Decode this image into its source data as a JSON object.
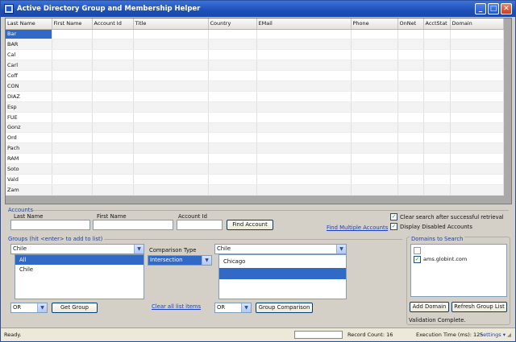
{
  "window": {
    "title": "Active Directory Group and Membership Helper",
    "buttons": {
      "minimize": "_",
      "maximize": "□",
      "close": "✕"
    }
  },
  "grid": {
    "columns": [
      "Last Name",
      "First Name",
      "Account Id",
      "Title",
      "Country",
      "EMail",
      "Phone",
      "OnNet",
      "AcctStat",
      "Domain"
    ],
    "rows": [
      [
        "Bar",
        "",
        "",
        "",
        "",
        "",
        "",
        "",
        "",
        ""
      ],
      [
        "BAR",
        "",
        "",
        "",
        "",
        "",
        "",
        "",
        "",
        ""
      ],
      [
        "Cal",
        "",
        "",
        "",
        "",
        "",
        "",
        "",
        "",
        ""
      ],
      [
        "Carl",
        "",
        "",
        "",
        "",
        "",
        "",
        "",
        "",
        ""
      ],
      [
        "Coff",
        "",
        "",
        "",
        "",
        "",
        "",
        "",
        "",
        ""
      ],
      [
        "CON",
        "",
        "",
        "",
        "",
        "",
        "",
        "",
        "",
        ""
      ],
      [
        "DIAZ",
        "",
        "",
        "",
        "",
        "",
        "",
        "",
        "",
        ""
      ],
      [
        "Esp",
        "",
        "",
        "",
        "",
        "",
        "",
        "",
        "",
        ""
      ],
      [
        "FUE",
        "",
        "",
        "",
        "",
        "",
        "",
        "",
        "",
        ""
      ],
      [
        "Gonz",
        "",
        "",
        "",
        "",
        "",
        "",
        "",
        "",
        ""
      ],
      [
        "Ord",
        "",
        "",
        "",
        "",
        "",
        "",
        "",
        "",
        ""
      ],
      [
        "Pach",
        "",
        "",
        "",
        "",
        "",
        "",
        "",
        "",
        ""
      ],
      [
        "RAM",
        "",
        "",
        "",
        "",
        "",
        "",
        "",
        "",
        ""
      ],
      [
        "Soto",
        "",
        "",
        "",
        "",
        "",
        "",
        "",
        "",
        ""
      ],
      [
        "Vald",
        "",
        "",
        "",
        "",
        "",
        "",
        "",
        "",
        ""
      ],
      [
        "Zam",
        "",
        "",
        "",
        "",
        "",
        "",
        "",
        "",
        ""
      ]
    ]
  },
  "accounts": {
    "section_label": "Accounts",
    "last_name_label": "Last Name",
    "first_name_label": "First Name",
    "account_id_label": "Account Id",
    "last_name_value": "",
    "first_name_value": "",
    "account_id_value": "",
    "find_account_button": "Find Account",
    "find_multiple_link": "Find Multiple Accounts",
    "clear_search_label": "Clear search after successful retrieval",
    "display_disabled_label": "Display Disabled Accounts"
  },
  "groups": {
    "section_label": "Groups (hit <enter> to add to list)",
    "selected_group": "Chile",
    "list_items": [
      "All",
      "Chile"
    ],
    "operator_value": "OR",
    "get_group_button": "Get Group"
  },
  "comparison": {
    "type_label": "Comparison Type",
    "type_value": "Intersection",
    "clear_all_link": "Clear all  list items",
    "selected_group": "Chile",
    "list_items": [
      "Chicago",
      ""
    ],
    "operator_value": "OR",
    "group_comparison_button": "Group Comparison"
  },
  "domains": {
    "section_label": "Domains to Search",
    "items": [
      {
        "label": "",
        "checked": false
      },
      {
        "label": "ams.globint.com",
        "checked": true
      }
    ],
    "add_domain_button": "Add Domain",
    "refresh_group_list_button": "Refresh Group List",
    "validation_text": "Validation Complete."
  },
  "status": {
    "ready_text": "Ready.",
    "record_count": "Record Count: 16",
    "execution_time": "Execution Time (ms): 125",
    "settings_label": "Settings ▾"
  }
}
